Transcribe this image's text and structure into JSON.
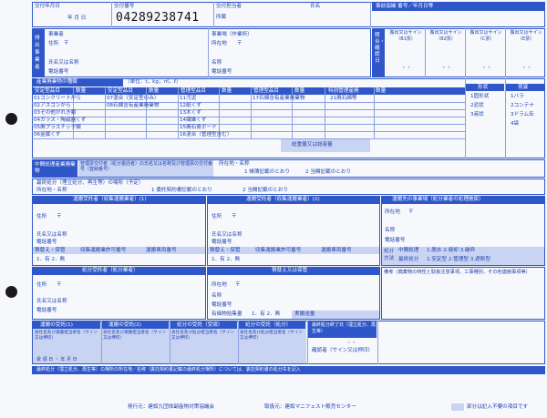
{
  "header": {
    "delivery_date_label": "交付年月日",
    "date_template": "年 月 日",
    "delivery_number_label": "交付番号",
    "delivery_number": "04289238741",
    "handler_label": "交付担当者",
    "handler_name_label": "氏名",
    "handler_dept_label": "所属",
    "agreement_label": "事前協議 番号／年月日等"
  },
  "discharger": {
    "side_label": "排出事業者",
    "company_label": "事業者",
    "address_label": "住所",
    "postal_mark": "〒",
    "name_label": "氏名又は名称",
    "phone_label": "電話番号",
    "site_label": "事業場（作業所）",
    "site_address_label": "所在地",
    "site_name_label": "名称",
    "site_phone_label": "電話番号"
  },
  "confirm": {
    "side_label": "照合・確認日",
    "b1": "搬出又はサイン（B1票）",
    "b2": "搬出又はサイン（B2票）",
    "c": "搬出又はサイン（C票）",
    "e": "搬出又はサイン（E票）",
    "date_template": "・・"
  },
  "waste": {
    "title": "産業廃棄物の種類",
    "unit_note": "（単位：t，kg，㎥，ℓ）",
    "col_headers": [
      "安定型品目",
      "数量",
      "安定型品目",
      "数量",
      "管理型品目",
      "数量",
      "管理型品目",
      "数量",
      "特別管理産廃",
      "数量"
    ],
    "col1": [
      "01コンクリートがら",
      "02アスコンがら",
      "03その他がれき類",
      "04ガラス・陶磁器くず",
      "05廃プラスチック類",
      "06金属くず"
    ],
    "col2": [
      "07混合（安定型のみ）",
      "08石綿含有産業廃棄物"
    ],
    "col3": [
      "11汚泥",
      "12紙くず",
      "13木くず",
      "14繊維くず",
      "15廃石膏ボード",
      "16混合（管理型含む）"
    ],
    "col4": [
      "17石綿含有産業廃棄物"
    ],
    "col5": [
      "21廃石綿等"
    ],
    "total_label": "総重量又は総容量",
    "form_header": "形状",
    "forms": [
      "1固形状",
      "2泥状",
      "3液状"
    ],
    "pack_header": "荷姿",
    "packs": [
      "1バラ",
      "2コンテナ",
      "3ドラム缶",
      "4袋"
    ]
  },
  "intermediate": {
    "side_label": "中間処理産業廃棄物",
    "label": "管理票交付者（処分委託者）の氏名又は名称及び管理票の交付番号（登録番号）",
    "location_label": "所在地・名称",
    "option1": "1 帳簿記載のとおり",
    "option2": "2 当欄記載のとおり"
  },
  "final": {
    "label": "最終処分（埋立処分、再生等）の場所（予定）",
    "location_label": "所在地・名称",
    "option1": "1 委託契約書記載のとおり",
    "option2": "2 当欄記載のとおり"
  },
  "transport1": {
    "title": "運搬受託者（収集運搬業者）(1)",
    "address_label": "住所",
    "postal_mark": "〒",
    "name_label": "氏名又は名称",
    "phone_label": "電話番号",
    "transfer_label": "積替え・保管",
    "permit_label": "収集運搬業許可番号",
    "vehicle_label": "運搬車両番号",
    "choices": "1．有 2．無"
  },
  "transport2": {
    "title": "運搬受託者（収集運搬業者）(2)",
    "address_label": "住所",
    "postal_mark": "〒",
    "name_label": "氏名又は名称",
    "phone_label": "電話番号",
    "transfer_label": "積替え・保管",
    "permit_label": "収集運搬業許可番号",
    "vehicle_label": "運搬車両番号",
    "choices": "1．有 2．無"
  },
  "destination": {
    "title": "運搬先の事業場（処分業者の処理施設）",
    "location_label": "所在地",
    "postal_mark": "〒",
    "name_label": "名称",
    "phone_label": "電話番号",
    "method_label": "処分方法",
    "method_row1_label": "中間処理",
    "method_row1": "1.脱水 2.焼却 3.破砕",
    "method_row2_label": "最終処分",
    "method_row2": "1.安定型 2.管理型 3.遮断型"
  },
  "disposal": {
    "title": "処分受託者（処分業者）",
    "address_label": "住所",
    "postal_mark": "〒",
    "name_label": "氏名又は名称",
    "phone_label": "電話番号"
  },
  "storage": {
    "title": "積替え又は保管",
    "location_label": "所在地",
    "postal_mark": "〒",
    "name_label": "名称",
    "phone_label": "電話番号",
    "valuables_label": "有価物拾集量",
    "valuables_choices": "1．有 2．無",
    "actual_label": "実搬送量"
  },
  "remarks": {
    "label": "備考（廃棄物の特性と取扱注意事項、工事種別、その他連絡事項等）"
  },
  "receipts": {
    "headers": [
      "運搬の受託(1)",
      "運搬の受託(2)",
      "処分の受託（受領）",
      "処分の受託（処分）"
    ],
    "sub1": "会社名及び運搬担当者名（サイン又は押印）",
    "sub3": "会社名及び処分担当者名（サイン又は押印）",
    "end_header": "最終処分終了日（埋立処分、再生等）",
    "end_date": "・・",
    "end_sign": "確認者（サイン又は押印）",
    "date_row": "受 領 日 ・ 年 月 日"
  },
  "footer_note": "最終処分（埋立処分、再生等）の場所の所在地／名称（委託契約書記載の最終処分場所）については、委託契約書の処分先を記入",
  "publisher": "発行元：建設九団体副産物対策協議会",
  "distributor": "取扱元：建設マニフェスト販売センター",
  "legend": "部分は記入不要の項目です"
}
